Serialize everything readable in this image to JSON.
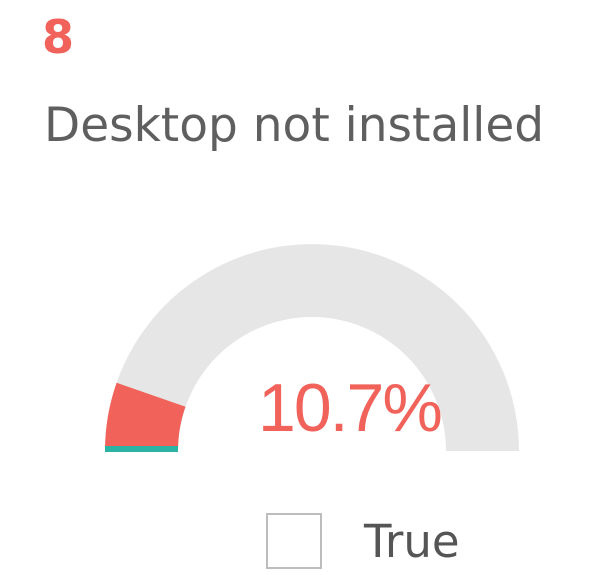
{
  "card": {
    "count": "8",
    "title": "Desktop not installed"
  },
  "gauge": {
    "value_label": "10.7%",
    "fraction": 0.107,
    "colors": {
      "fill": "#F0625A",
      "track": "#E6E6E6",
      "baseline_accent": "#2BB3A3"
    }
  },
  "legend": {
    "items": [
      {
        "label": "True",
        "checked": false
      }
    ]
  }
}
